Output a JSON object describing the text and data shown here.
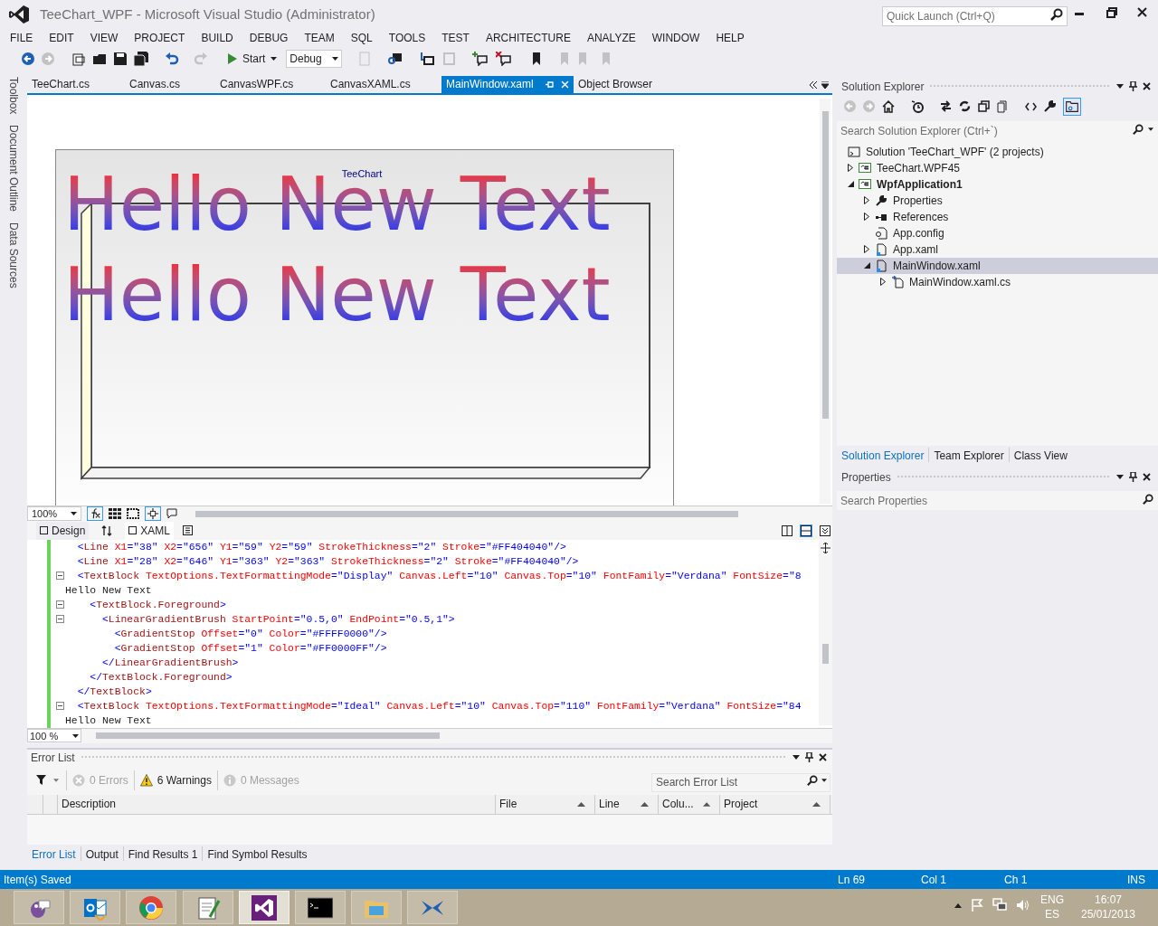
{
  "window": {
    "title": "TeeChart_WPF - Microsoft Visual Studio (Administrator)"
  },
  "quick_launch": {
    "placeholder": "Quick Launch (Ctrl+Q)"
  },
  "menu": [
    "FILE",
    "EDIT",
    "VIEW",
    "PROJECT",
    "BUILD",
    "DEBUG",
    "TEAM",
    "SQL",
    "TOOLS",
    "TEST",
    "ARCHITECTURE",
    "ANALYZE",
    "WINDOW",
    "HELP"
  ],
  "toolbar": {
    "start": "Start",
    "configuration": "Debug"
  },
  "side_tabs": [
    "Toolbox",
    "Document Outline",
    "Data Sources"
  ],
  "doc_tabs": [
    {
      "label": "TeeChart.cs",
      "selected": false
    },
    {
      "label": "Canvas.cs",
      "selected": false
    },
    {
      "label": "CanvasWPF.cs",
      "selected": false
    },
    {
      "label": "CanvasXAML.cs",
      "selected": false
    },
    {
      "label": "MainWindow.xaml",
      "selected": true
    },
    {
      "label": "Object Browser",
      "selected": false
    }
  ],
  "designer": {
    "chart_title": "TeeChart",
    "texts": [
      "Hello New Text",
      "Hello New Text"
    ],
    "zoom": "100%"
  },
  "view_tabs": [
    {
      "label": "Design",
      "selected": false
    },
    {
      "label": "XAML",
      "selected": true
    }
  ],
  "code_lines": [
    {
      "text": "  <Line X1=\"38\" X2=\"656\" Y1=\"59\" Y2=\"59\" StrokeThickness=\"2\" Stroke=\"#FF404040\"/>",
      "collapsible": false
    },
    {
      "text": "  <Line X1=\"28\" X2=\"646\" Y1=\"363\" Y2=\"363\" StrokeThickness=\"2\" Stroke=\"#FF404040\"/>",
      "collapsible": false
    },
    {
      "text": "  <TextBlock TextOptions.TextFormattingMode=\"Display\" Canvas.Left=\"10\" Canvas.Top=\"10\" FontFamily=\"Verdana\" FontSize=\"8",
      "collapsible": true
    },
    {
      "text": "Hello New Text",
      "collapsible": false
    },
    {
      "text": "    <TextBlock.Foreground>",
      "collapsible": true
    },
    {
      "text": "      <LinearGradientBrush StartPoint=\"0.5,0\" EndPoint=\"0.5,1\">",
      "collapsible": true
    },
    {
      "text": "        <GradientStop Offset=\"0\" Color=\"#FFFF0000\"/>",
      "collapsible": false
    },
    {
      "text": "        <GradientStop Offset=\"1\" Color=\"#FF0000FF\"/>",
      "collapsible": false
    },
    {
      "text": "      </LinearGradientBrush>",
      "collapsible": false
    },
    {
      "text": "    </TextBlock.Foreground>",
      "collapsible": false
    },
    {
      "text": "  </TextBlock>",
      "collapsible": false
    },
    {
      "text": "  <TextBlock TextOptions.TextFormattingMode=\"Ideal\" Canvas.Left=\"10\" Canvas.Top=\"110\" FontFamily=\"Verdana\" FontSize=\"84",
      "collapsible": true
    },
    {
      "text": "Hello New Text",
      "collapsible": false
    }
  ],
  "code_zoom": "100 %",
  "error_list": {
    "title": "Error List",
    "filters": [
      {
        "label": "0 Errors",
        "kind": "error",
        "active": false
      },
      {
        "label": "6 Warnings",
        "kind": "warning",
        "active": true
      },
      {
        "label": "0 Messages",
        "kind": "info",
        "active": false
      }
    ],
    "search": {
      "placeholder": "Search Error List"
    },
    "columns": [
      {
        "label": "Description",
        "sortable": false
      },
      {
        "label": "File",
        "sortable": true
      },
      {
        "label": "Line",
        "sortable": true
      },
      {
        "label": "Colu...",
        "sortable": true
      },
      {
        "label": "Project",
        "sortable": true
      }
    ]
  },
  "bottom_tabs": [
    {
      "label": "Error List",
      "selected": true
    },
    {
      "label": "Output",
      "selected": false
    },
    {
      "label": "Find Results 1",
      "selected": false
    },
    {
      "label": "Find Symbol Results",
      "selected": false
    }
  ],
  "solution_explorer": {
    "title": "Solution Explorer",
    "search": {
      "placeholder": "Search Solution Explorer (Ctrl+`)"
    },
    "tree": [
      {
        "label": "Solution 'TeeChart_WPF' (2 projects)",
        "kind": "solution",
        "selected": false,
        "children": [
          {
            "label": "TeeChart.WPF45",
            "kind": "project",
            "startup": false,
            "expanded": false,
            "selected": false
          },
          {
            "label": "WpfApplication1",
            "kind": "project",
            "startup": true,
            "expanded": true,
            "selected": false,
            "children": [
              {
                "label": "Properties",
                "kind": "properties",
                "expanded": false,
                "selected": false
              },
              {
                "label": "References",
                "kind": "references",
                "expanded": false,
                "selected": false
              },
              {
                "label": "App.config",
                "kind": "config",
                "selected": false
              },
              {
                "label": "App.xaml",
                "kind": "xaml",
                "expanded": false,
                "selected": false
              },
              {
                "label": "MainWindow.xaml",
                "kind": "xaml",
                "expanded": true,
                "selected": true,
                "children": [
                  {
                    "label": "MainWindow.xaml.cs",
                    "kind": "code",
                    "expanded": false,
                    "selected": false
                  }
                ]
              }
            ]
          }
        ]
      }
    ]
  },
  "panel_tabs": [
    {
      "label": "Solution Explorer",
      "selected": true
    },
    {
      "label": "Team Explorer",
      "selected": false
    },
    {
      "label": "Class View",
      "selected": false
    }
  ],
  "properties": {
    "title": "Properties",
    "search": {
      "placeholder": "Search Properties"
    }
  },
  "status_bar": {
    "message": "Item(s) Saved",
    "line": "Ln 69",
    "column": "Col 1",
    "char": "Ch 1",
    "mode": "INS"
  },
  "taskbar": {
    "apps": [
      {
        "kind": "bird",
        "selected": false
      },
      {
        "kind": "mail",
        "selected": false
      },
      {
        "kind": "browser",
        "selected": false
      },
      {
        "kind": "notepad",
        "selected": false
      },
      {
        "kind": "vs",
        "selected": true
      },
      {
        "kind": "terminal",
        "selected": false
      },
      {
        "kind": "folder",
        "selected": false
      },
      {
        "kind": "x",
        "selected": false
      }
    ],
    "language": "ENG",
    "layout": "ES",
    "time": "16:07",
    "date": "25/01/2013"
  }
}
